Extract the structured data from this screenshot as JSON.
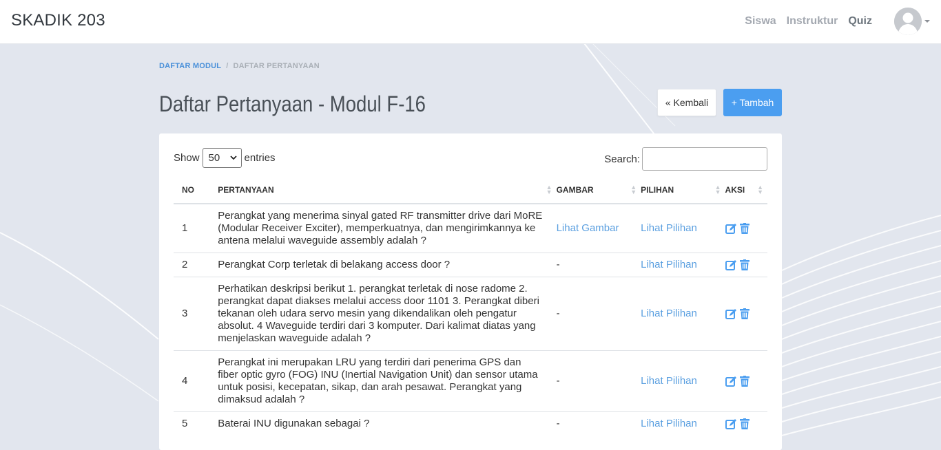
{
  "app": {
    "brand": "SKADIK 203"
  },
  "nav": {
    "links": [
      {
        "label": "Siswa"
      },
      {
        "label": "Instruktur"
      },
      {
        "label": "Quiz"
      }
    ]
  },
  "breadcrumb": {
    "parent": "DAFTAR MODUL",
    "current": "DAFTAR PERTANYAAN"
  },
  "page": {
    "title": "Daftar Pertanyaan - Modul F-16",
    "back_label": "« Kembali",
    "add_label": "+ Tambah"
  },
  "table_controls": {
    "show_label": "Show",
    "entries_label": "entries",
    "page_size": "50",
    "search_label": "Search:",
    "search_value": ""
  },
  "table": {
    "headers": [
      "NO",
      "PERTANYAAN",
      "GAMBAR",
      "PILIHAN",
      "AKSI"
    ],
    "rows": [
      {
        "no": "1",
        "question": "Perangkat yang menerima sinyal gated RF transmitter drive dari MoRE (Modular Receiver Exciter), memperkuatnya, dan mengirimkannya ke antena melalui waveguide assembly adalah ?",
        "image": "Lihat Gambar",
        "options": "Lihat Pilihan"
      },
      {
        "no": "2",
        "question": "Perangkat Corp terletak di belakang access door ?",
        "image": "-",
        "options": "Lihat Pilihan"
      },
      {
        "no": "3",
        "question": "Perhatikan deskripsi berikut 1. perangkat terletak di nose radome 2. perangkat dapat diakses melalui access door 1101 3. Perangkat diberi tekanan oleh udara servo mesin yang dikendalikan oleh pengatur absolut. 4 Waveguide terdiri dari 3 komputer. Dari kalimat diatas yang menjelaskan waveguide adalah ?",
        "image": "-",
        "options": "Lihat Pilihan"
      },
      {
        "no": "4",
        "question": "Perangkat ini merupakan LRU yang terdiri dari penerima GPS dan fiber optic gyro (FOG) INU (Inertial Navigation Unit) dan sensor utama untuk posisi, kecepatan, sikap, dan arah pesawat. Perangkat yang dimaksud adalah ?",
        "image": "-",
        "options": "Lihat Pilihan"
      },
      {
        "no": "5",
        "question": "Baterai INU digunakan sebagai ?",
        "image": "-",
        "options": "Lihat Pilihan"
      }
    ]
  },
  "icons": {
    "edit": "edit-icon",
    "delete": "trash-icon",
    "avatar": "user-avatar-icon"
  },
  "colors": {
    "accent": "#4b9ef0",
    "link": "#5a9fe0",
    "background": "#e2e6ee"
  }
}
